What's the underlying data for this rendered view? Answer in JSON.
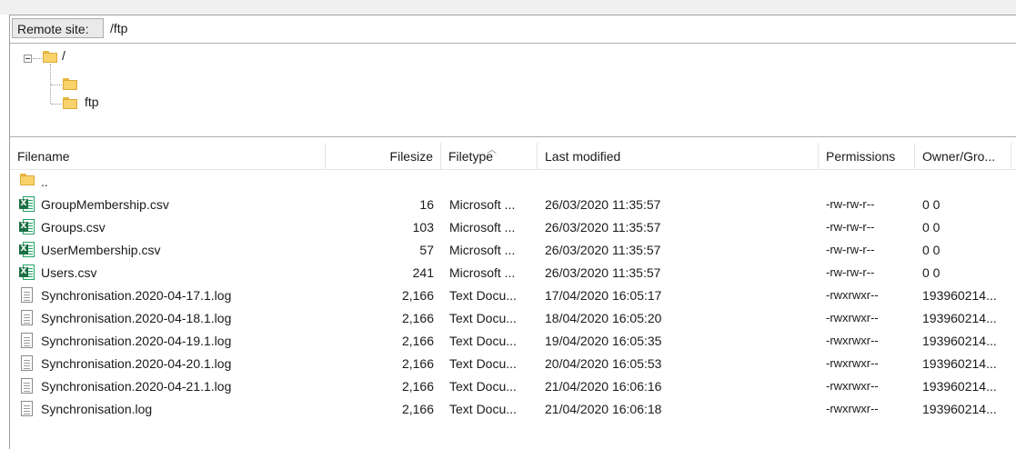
{
  "remote_site": {
    "label": "Remote site:",
    "path": "/ftp"
  },
  "tree": {
    "root": {
      "label": "/",
      "icon": "folder-icon"
    },
    "children": [
      {
        "label": "",
        "icon": "folder-icon"
      },
      {
        "label": "ftp",
        "icon": "folder-icon"
      }
    ]
  },
  "columns": [
    {
      "key": "filename",
      "label": "Filename"
    },
    {
      "key": "filesize",
      "label": "Filesize"
    },
    {
      "key": "filetype",
      "label": "Filetype",
      "sorted": true
    },
    {
      "key": "last_modified",
      "label": "Last modified"
    },
    {
      "key": "permissions",
      "label": "Permissions"
    },
    {
      "key": "owner",
      "label": "Owner/Gro..."
    }
  ],
  "files": [
    {
      "name": "..",
      "size": "",
      "type": "",
      "modified": "",
      "permissions": "",
      "owner": "",
      "icon": "folder-icon"
    },
    {
      "name": "GroupMembership.csv",
      "size": "16",
      "type": "Microsoft ...",
      "modified": "26/03/2020 11:35:57",
      "permissions": "-rw-rw-r--",
      "owner": "0 0",
      "icon": "excel-csv-icon"
    },
    {
      "name": "Groups.csv",
      "size": "103",
      "type": "Microsoft ...",
      "modified": "26/03/2020 11:35:57",
      "permissions": "-rw-rw-r--",
      "owner": "0 0",
      "icon": "excel-csv-icon"
    },
    {
      "name": "UserMembership.csv",
      "size": "57",
      "type": "Microsoft ...",
      "modified": "26/03/2020 11:35:57",
      "permissions": "-rw-rw-r--",
      "owner": "0 0",
      "icon": "excel-csv-icon"
    },
    {
      "name": "Users.csv",
      "size": "241",
      "type": "Microsoft ...",
      "modified": "26/03/2020 11:35:57",
      "permissions": "-rw-rw-r--",
      "owner": "0 0",
      "icon": "excel-csv-icon"
    },
    {
      "name": "Synchronisation.2020-04-17.1.log",
      "size": "2,166",
      "type": "Text Docu...",
      "modified": "17/04/2020 16:05:17",
      "permissions": "-rwxrwxr--",
      "owner": "193960214...",
      "icon": "text-document-icon"
    },
    {
      "name": "Synchronisation.2020-04-18.1.log",
      "size": "2,166",
      "type": "Text Docu...",
      "modified": "18/04/2020 16:05:20",
      "permissions": "-rwxrwxr--",
      "owner": "193960214...",
      "icon": "text-document-icon"
    },
    {
      "name": "Synchronisation.2020-04-19.1.log",
      "size": "2,166",
      "type": "Text Docu...",
      "modified": "19/04/2020 16:05:35",
      "permissions": "-rwxrwxr--",
      "owner": "193960214...",
      "icon": "text-document-icon"
    },
    {
      "name": "Synchronisation.2020-04-20.1.log",
      "size": "2,166",
      "type": "Text Docu...",
      "modified": "20/04/2020 16:05:53",
      "permissions": "-rwxrwxr--",
      "owner": "193960214...",
      "icon": "text-document-icon"
    },
    {
      "name": "Synchronisation.2020-04-21.1.log",
      "size": "2,166",
      "type": "Text Docu...",
      "modified": "21/04/2020 16:06:16",
      "permissions": "-rwxrwxr--",
      "owner": "193960214...",
      "icon": "text-document-icon"
    },
    {
      "name": "Synchronisation.log",
      "size": "2,166",
      "type": "Text Docu...",
      "modified": "21/04/2020 16:06:18",
      "permissions": "-rwxrwxr--",
      "owner": "193960214...",
      "icon": "text-document-icon"
    }
  ]
}
